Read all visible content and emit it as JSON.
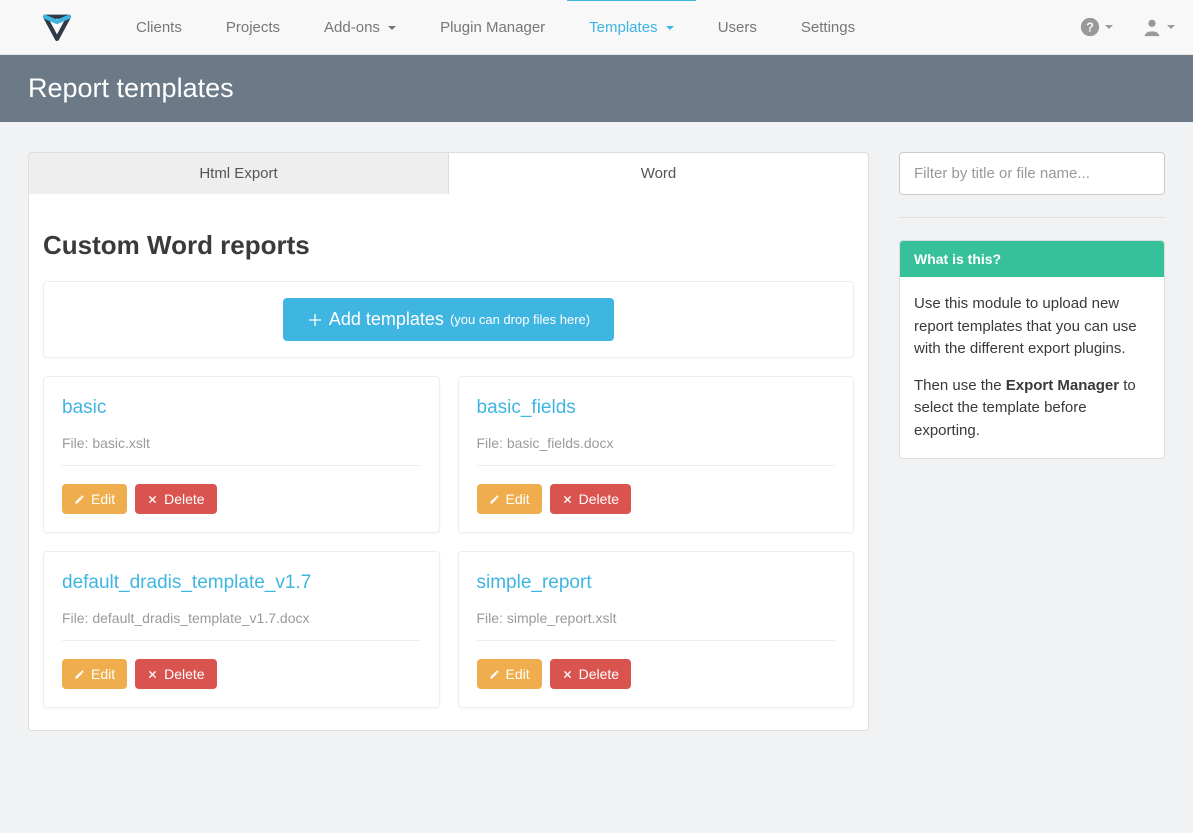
{
  "nav": {
    "items": [
      {
        "label": "Clients",
        "dropdown": false,
        "active": false
      },
      {
        "label": "Projects",
        "dropdown": false,
        "active": false
      },
      {
        "label": "Add-ons",
        "dropdown": true,
        "active": false
      },
      {
        "label": "Plugin Manager",
        "dropdown": false,
        "active": false
      },
      {
        "label": "Templates",
        "dropdown": true,
        "active": true
      },
      {
        "label": "Users",
        "dropdown": false,
        "active": false
      },
      {
        "label": "Settings",
        "dropdown": false,
        "active": false
      }
    ]
  },
  "page": {
    "title": "Report templates"
  },
  "tabs": [
    {
      "label": "Html Export",
      "active": false
    },
    {
      "label": "Word",
      "active": true
    }
  ],
  "panel": {
    "heading": "Custom Word reports",
    "add_button": {
      "label": "Add templates",
      "hint": "(you can drop files here)"
    }
  },
  "templates": [
    {
      "title": "basic",
      "file_label": "File: basic.xslt"
    },
    {
      "title": "basic_fields",
      "file_label": "File: basic_fields.docx"
    },
    {
      "title": "default_dradis_template_v1.7",
      "file_label": "File: default_dradis_template_v1.7.docx"
    },
    {
      "title": "simple_report",
      "file_label": "File: simple_report.xslt"
    }
  ],
  "buttons": {
    "edit": "Edit",
    "delete": "Delete"
  },
  "sidebar": {
    "filter_placeholder": "Filter by title or file name...",
    "info": {
      "heading": "What is this?",
      "p1": "Use this module to upload new report templates that you can use with the different export plugins.",
      "p2_a": "Then use the ",
      "p2_b": "Export Manager",
      "p2_c": " to select the template before exporting."
    }
  }
}
